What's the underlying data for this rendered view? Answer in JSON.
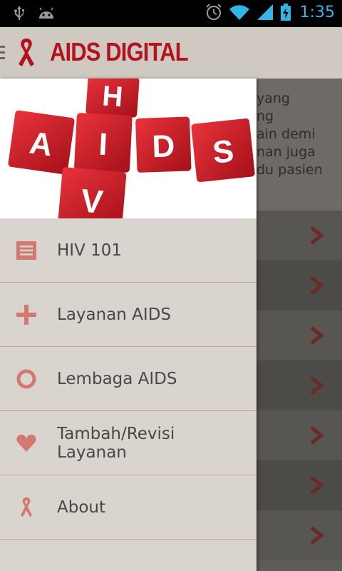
{
  "status_bar": {
    "time": "1:35",
    "icons_left": [
      "usb-icon",
      "android-debug-icon"
    ],
    "icons_right": [
      "alarm-icon",
      "wifi-icon",
      "signal-icon",
      "battery-charging-icon"
    ]
  },
  "action_bar": {
    "title": "AIDS DIGITAL",
    "logo": "ribbon-icon"
  },
  "banner": {
    "tiles": [
      "H",
      "A",
      "I",
      "D",
      "S",
      "V"
    ]
  },
  "background": {
    "text": "yang\nng\nain demi\nnan juga\ndu pasien"
  },
  "drawer": {
    "items": [
      {
        "label": "HIV 101",
        "icon": "list-icon"
      },
      {
        "label": "Layanan AIDS",
        "icon": "plus-icon"
      },
      {
        "label": "Lembaga AIDS",
        "icon": "circle-icon"
      },
      {
        "label": "Tambah/Revisi\nLayanan",
        "icon": "heart-icon"
      },
      {
        "label": "About",
        "icon": "ribbon-icon"
      }
    ]
  },
  "colors": {
    "accent_red": "#b3121f",
    "icon_pink": "#d27a72",
    "drawer_bg": "#d9d4cd",
    "action_bar_bg": "#cfc9c1",
    "status_blue": "#33b5e5"
  }
}
